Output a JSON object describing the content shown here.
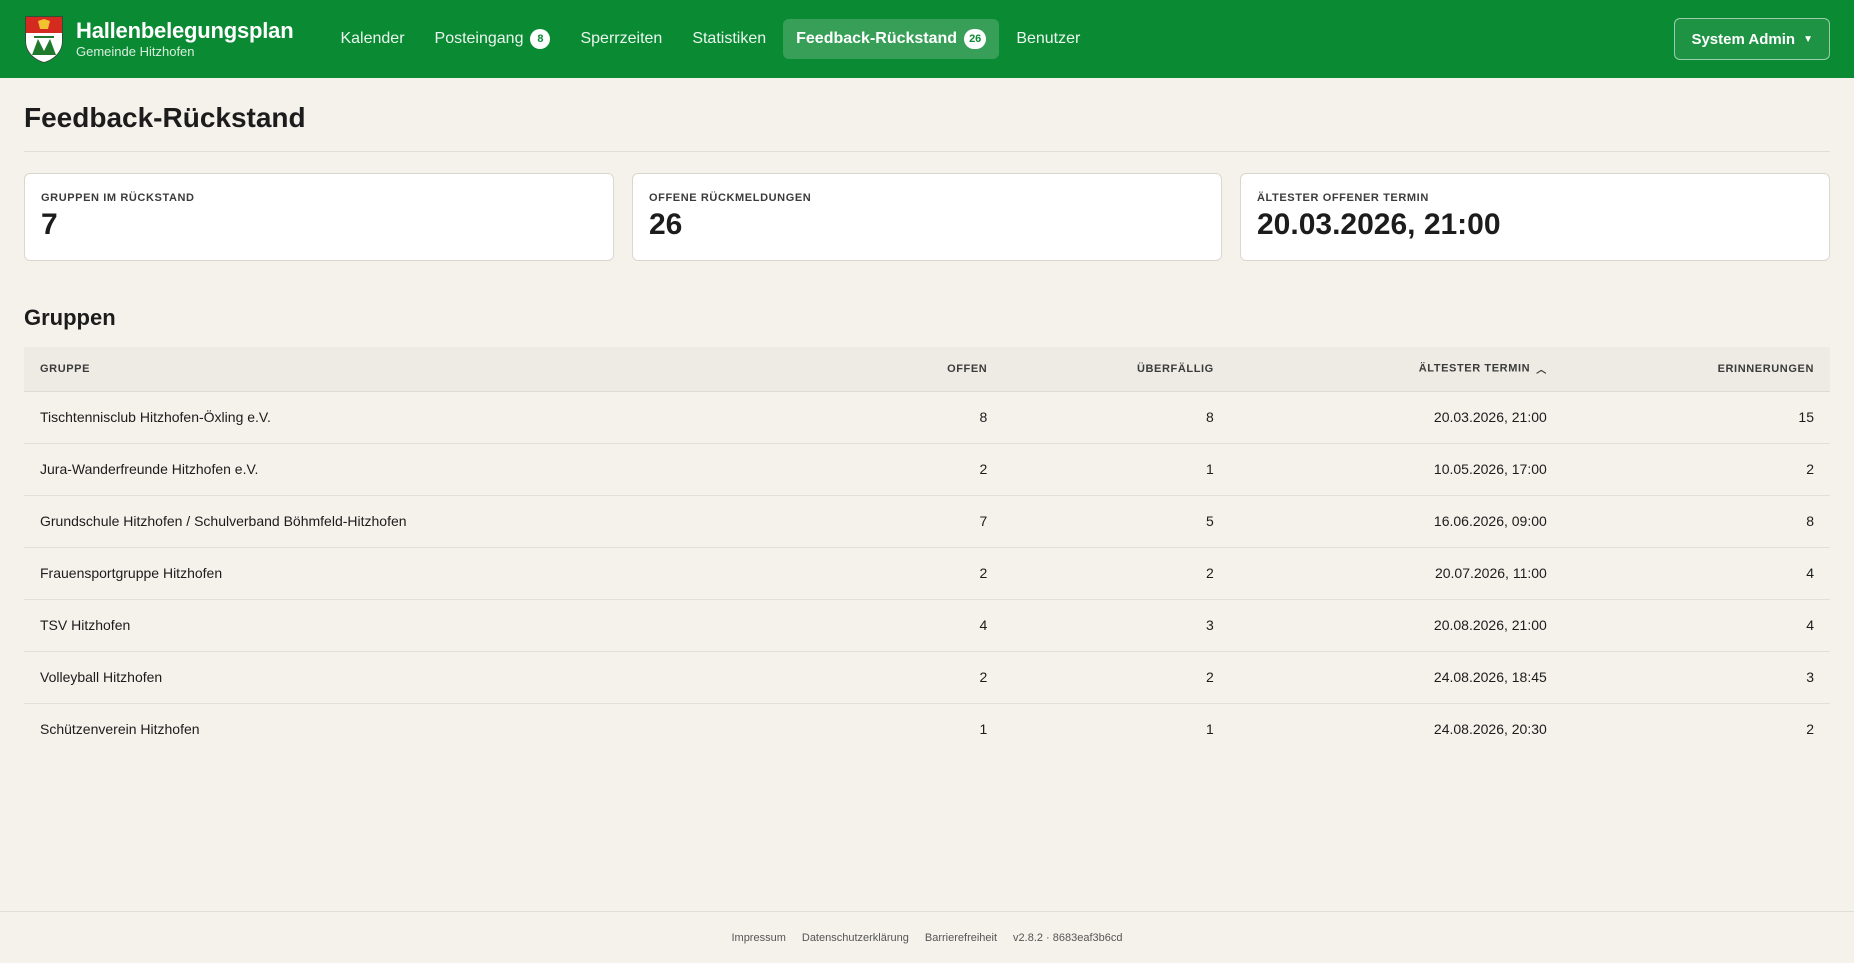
{
  "header": {
    "title": "Hallenbelegungsplan",
    "subtitle": "Gemeinde Hitzhofen",
    "brand_color": "#0b8a34"
  },
  "nav": {
    "calendar": "Kalender",
    "inbox": "Posteingang",
    "inbox_badge": "8",
    "blocked": "Sperrzeiten",
    "stats": "Statistiken",
    "feedback": "Feedback-Rückstand",
    "feedback_badge": "26",
    "users": "Benutzer"
  },
  "user_menu": {
    "label": "System Admin",
    "icon": "caret-down-icon"
  },
  "page": {
    "title": "Feedback-Rückstand"
  },
  "stats": [
    {
      "label": "Gruppen im Rückstand",
      "value": "7"
    },
    {
      "label": "Offene Rückmeldungen",
      "value": "26"
    },
    {
      "label": "Ältester offener Termin",
      "value": "20.03.2026, 21:00"
    }
  ],
  "groups": {
    "title": "Gruppen",
    "columns": {
      "group": "Gruppe",
      "open": "Offen",
      "overdue": "Überfällig",
      "oldest": "Ältester Termin",
      "reminders": "Erinnerungen"
    },
    "sort": {
      "column": "oldest",
      "direction": "ascending",
      "icon": "chevron-up-icon"
    },
    "rows": [
      {
        "name": "Tischtennisclub Hitzhofen-Öxling e.V.",
        "open": "8",
        "overdue": "8",
        "oldest": "20.03.2026, 21:00",
        "reminders": "15"
      },
      {
        "name": "Jura-Wanderfreunde Hitzhofen e.V.",
        "open": "2",
        "overdue": "1",
        "oldest": "10.05.2026, 17:00",
        "reminders": "2"
      },
      {
        "name": "Grundschule Hitzhofen / Schulverband Böhmfeld-Hitzhofen",
        "open": "7",
        "overdue": "5",
        "oldest": "16.06.2026, 09:00",
        "reminders": "8"
      },
      {
        "name": "Frauensportgruppe Hitzhofen",
        "open": "2",
        "overdue": "2",
        "oldest": "20.07.2026, 11:00",
        "reminders": "4"
      },
      {
        "name": "TSV Hitzhofen",
        "open": "4",
        "overdue": "3",
        "oldest": "20.08.2026, 21:00",
        "reminders": "4"
      },
      {
        "name": "Volleyball Hitzhofen",
        "open": "2",
        "overdue": "2",
        "oldest": "24.08.2026, 18:45",
        "reminders": "3"
      },
      {
        "name": "Schützenverein Hitzhofen",
        "open": "1",
        "overdue": "1",
        "oldest": "24.08.2026, 20:30",
        "reminders": "2"
      }
    ]
  },
  "footer": {
    "imprint": "Impressum",
    "privacy": "Datenschutzerklärung",
    "accessibility": "Barrierefreiheit",
    "version": "v2.8.2 · 8683eaf3b6cd"
  }
}
